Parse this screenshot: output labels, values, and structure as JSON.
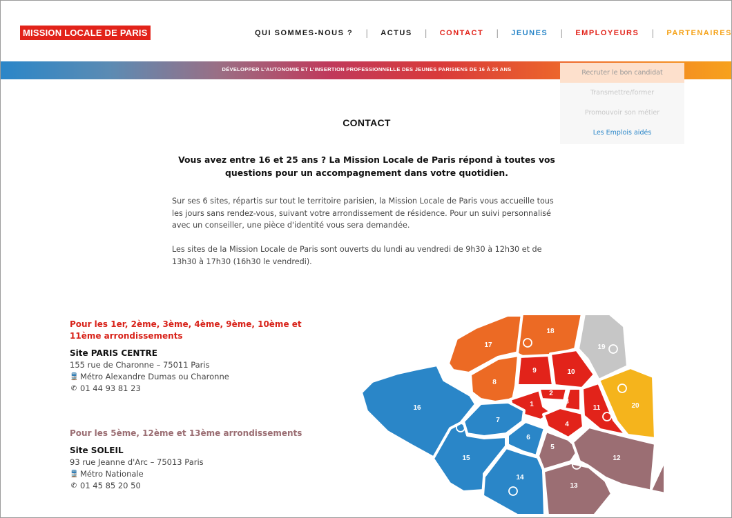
{
  "header": {
    "logo": "MISSION LOCALE DE PARIS",
    "nav": [
      "QUI SOMMES-NOUS ?",
      "ACTUS",
      "CONTACT",
      "JEUNES",
      "EMPLOYEURS",
      "PARTENAIRES"
    ],
    "tagline": "DÉVELOPPER L'AUTONOMIE ET L'INSERTION PROFESSIONNELLE DES JEUNES PARISIENS DE 16 À 25 ANS"
  },
  "dropdown": [
    "Recruter le bon candidat",
    "Transmettre/former",
    "Promouvoir son métier",
    "Les Emplois aidés"
  ],
  "content": {
    "title": "CONTACT",
    "intro": "Vous avez entre 16 et 25 ans ? La Mission Locale de Paris répond à toutes vos questions pour un accompagnement dans votre quotidien.",
    "para1": "Sur ses 6 sites, répartis sur tout le territoire parisien, la Mission Locale de Paris vous accueille tous les jours sans rendez-vous, suivant votre arrondissement de résidence. Pour un suivi personnalisé avec un conseiller, une pièce d'identité vous sera demandée.",
    "para2": "Les sites de la Mission Locale de Paris sont ouverts du lundi au vendredi de 9h30 à 12h30 et de 13h30 à 17h30 (16h30 le vendredi)."
  },
  "sites": [
    {
      "areas": "Pour les 1er, 2ème, 3ème, 4ème, 9ème, 10ème et 11ème arrondissements",
      "name": "Site PARIS CENTRE",
      "address": "155 rue de Charonne – 75011 Paris",
      "metro": "Métro Alexandre Dumas ou Charonne",
      "phone": "01 44 93 81 23"
    },
    {
      "areas": "Pour les 5ème, 12ème et 13ème arrondissements",
      "name": "Site SOLEIL",
      "address": "93 rue Jeanne d'Arc – 75013 Paris",
      "metro": "Métro Nationale",
      "phone": "01 45 85 20 50"
    }
  ],
  "map": {
    "labels": {
      "1": "1",
      "2": "2",
      "3": "3",
      "4": "4",
      "5": "5",
      "6": "6",
      "7": "7",
      "8": "8",
      "9": "9",
      "10": "10",
      "11": "11",
      "12": "12",
      "13": "13",
      "14": "14",
      "15": "15",
      "16": "16",
      "17": "17",
      "18": "18",
      "19": "19",
      "20": "20"
    }
  },
  "colors": {
    "brand_red": "#e2231a",
    "jeunes_blue": "#2a86c8",
    "partenaires_orange": "#f5a31a",
    "centre_red": "#e2231a",
    "soleil_mauve": "#9b6e73",
    "west_orange": "#ec6a24",
    "north_grey": "#c6c6c6",
    "east_yellow": "#f5b41c"
  }
}
